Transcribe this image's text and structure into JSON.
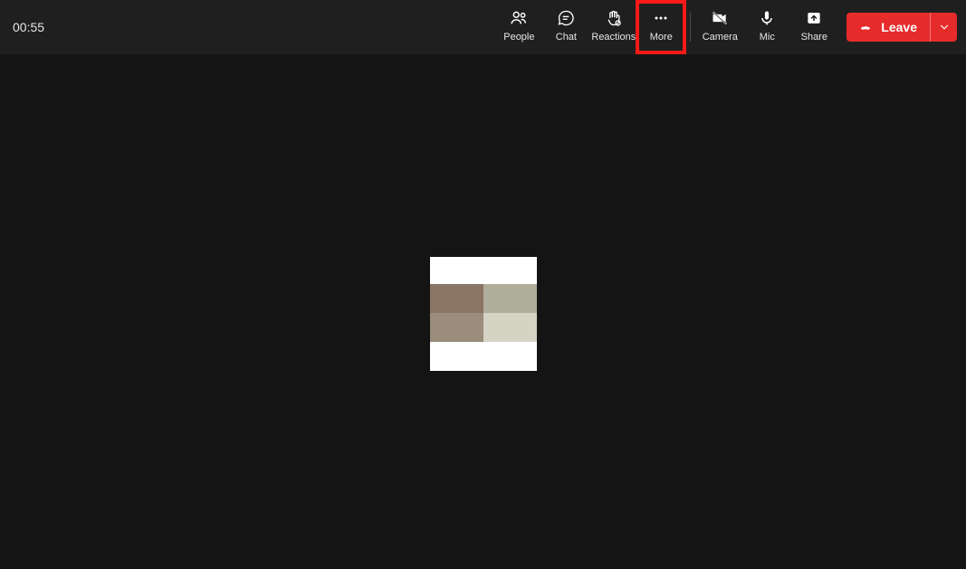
{
  "timer": "00:55",
  "toolbar": {
    "people_label": "People",
    "chat_label": "Chat",
    "reactions_label": "Reactions",
    "more_label": "More",
    "camera_label": "Camera",
    "mic_label": "Mic",
    "share_label": "Share"
  },
  "leave": {
    "label": "Leave"
  },
  "highlight": {
    "target": "more-button"
  }
}
